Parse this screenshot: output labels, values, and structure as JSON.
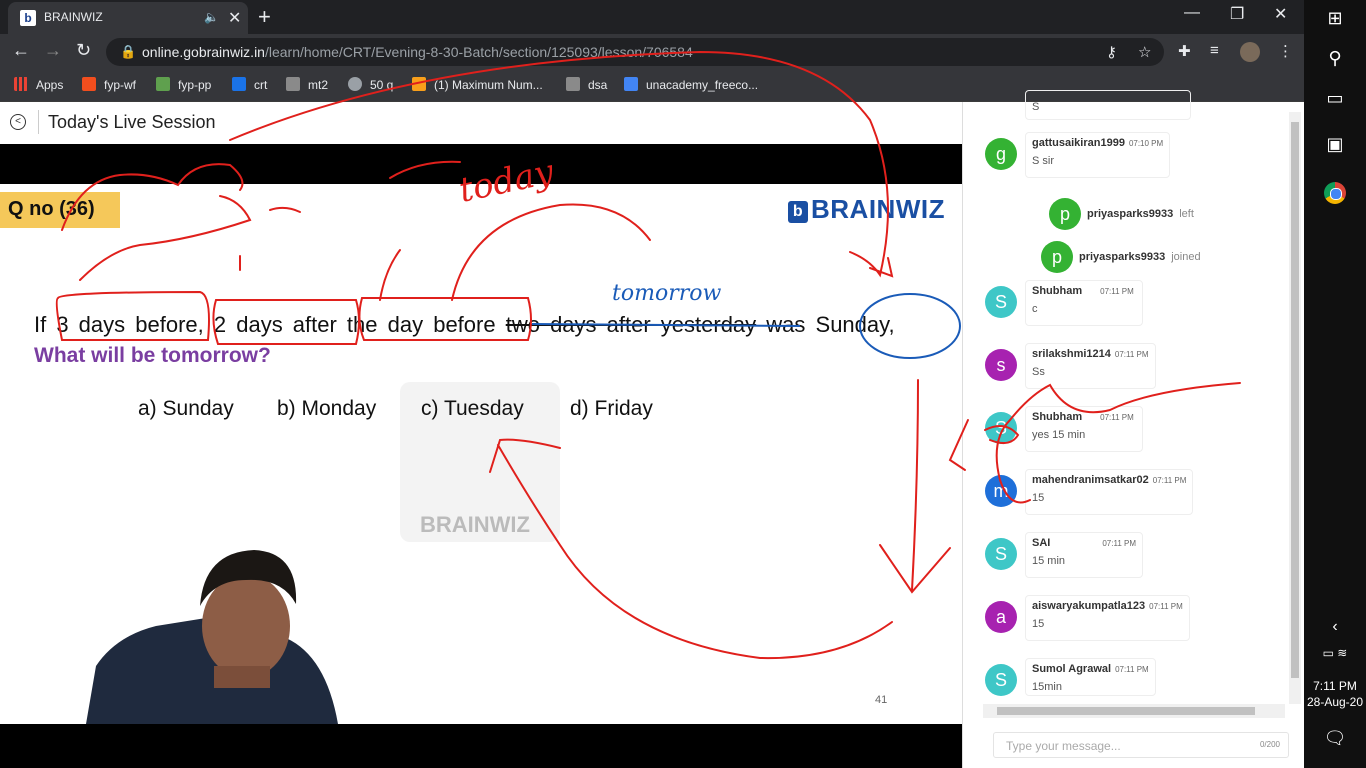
{
  "browser": {
    "tab_title": "BRAINWIZ",
    "tab_favicon": "b",
    "url_host": "online.gobrainwiz.in",
    "url_path": "/learn/home/CRT/Evening-8-30-Batch/section/125093/lesson/706584",
    "bookmarks": [
      {
        "label": "Apps",
        "icon": "apps-grid-icon",
        "color": "#ea4335"
      },
      {
        "label": "fyp-wf",
        "icon": "figma-icon",
        "color": "#f24e1e"
      },
      {
        "label": "fyp-pp",
        "icon": "pp-icon",
        "color": "#5fa04e"
      },
      {
        "label": "crt",
        "icon": "brainwiz-icon",
        "color": "#1a73e8"
      },
      {
        "label": "mt2",
        "icon": "cc-icon",
        "color": "#8a8a8a"
      },
      {
        "label": "50 q",
        "icon": "globe-icon",
        "color": "#9aa0a6"
      },
      {
        "label": "(1) Maximum Num...",
        "icon": "leetcode-icon",
        "color": "#f89f1b"
      },
      {
        "label": "dsa",
        "icon": "cc-icon",
        "color": "#8a8a8a"
      },
      {
        "label": "unacademy_freeco...",
        "icon": "unacademy-icon",
        "color": "#4285f4"
      }
    ]
  },
  "session": {
    "title": "Today's Live Session"
  },
  "slide": {
    "question_number": "Q no (36)",
    "brand": "BRAINWIZ",
    "q_part1": "If 3 days before, 2 days after the day before ",
    "q_strike": "two days after yesterday",
    "q_part2": " was Sunday,",
    "q_line2": "What will be tomorrow?",
    "options": [
      "a) Sunday",
      "b) Monday",
      "c) Tuesday",
      "d) Friday"
    ],
    "watermark": "BRAINWIZ",
    "slide_number": "41"
  },
  "chat": {
    "messages": [
      {
        "kind": "msg",
        "initial": "g",
        "color": "#34b233",
        "name": "gattusaikiran1999",
        "time": "07:10 PM",
        "text": "S sir"
      },
      {
        "kind": "sys",
        "initial": "p",
        "color": "#34b233",
        "name": "priyasparks9933",
        "action": "left"
      },
      {
        "kind": "sys",
        "initial": "p",
        "color": "#34b233",
        "name": "priyasparks9933",
        "action": "joined"
      },
      {
        "kind": "msg",
        "initial": "S",
        "color": "#3ec7c7",
        "name": "Shubham",
        "time": "07:11 PM",
        "text": "c"
      },
      {
        "kind": "msg",
        "initial": "s",
        "color": "#a722b0",
        "name": "srilakshmi1214",
        "time": "07:11 PM",
        "text": "Ss"
      },
      {
        "kind": "msg",
        "initial": "S",
        "color": "#3ec7c7",
        "name": "Shubham",
        "time": "07:11 PM",
        "text": "yes 15 min"
      },
      {
        "kind": "msg",
        "initial": "m",
        "color": "#1e6fd9",
        "name": "mahendranimsatkar02",
        "time": "07:11 PM",
        "text": "15"
      },
      {
        "kind": "msg",
        "initial": "S",
        "color": "#3ec7c7",
        "name": "SAI",
        "time": "07:11 PM",
        "text": "15 min"
      },
      {
        "kind": "msg",
        "initial": "a",
        "color": "#a722b0",
        "name": "aiswaryakumpatla123",
        "time": "07:11 PM",
        "text": "15"
      },
      {
        "kind": "msg",
        "initial": "S",
        "color": "#3ec7c7",
        "name": "Sumol Agrawal",
        "time": "07:11 PM",
        "text": "15min"
      }
    ],
    "top_partial_text": "S",
    "input_placeholder": "Type your message...",
    "char_counter": "0/200"
  },
  "taskbar": {
    "time": "7:11 PM",
    "date": "28-Aug-20"
  },
  "annotations": {
    "handwriting_today": "today",
    "handwriting_tomorrow": "tomorrow",
    "ink_color": "#e0201c"
  }
}
